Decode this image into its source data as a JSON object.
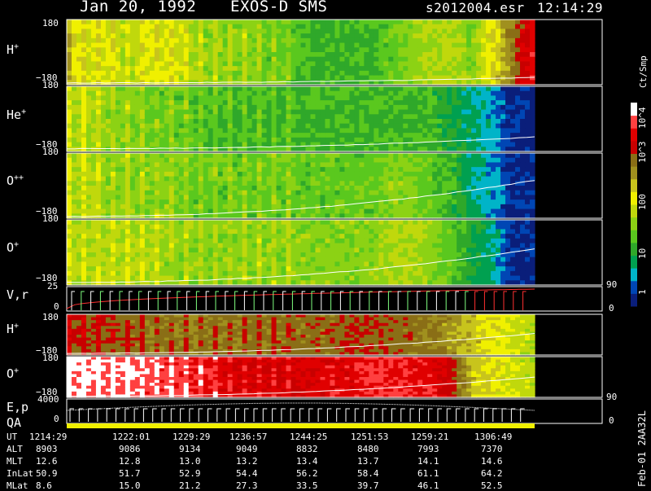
{
  "header": {
    "date": "Jan 20, 1992",
    "instrument": "EXOS-D SMS",
    "file": "s2012004.esr",
    "time": "12:14:29"
  },
  "colorbar": {
    "units": "Ct/Smp",
    "ticks": [
      "10^4",
      "10^3",
      "100",
      "10",
      "1"
    ]
  },
  "panels": {
    "p1": {
      "label": "H",
      "sup": "+",
      "ymax": "180",
      "ymin": "−180"
    },
    "p2": {
      "label": "He",
      "sup": "+",
      "ymax": "180",
      "ymin": "−180"
    },
    "p3": {
      "label": "O",
      "sup": "++",
      "ymax": "180",
      "ymin": "−180"
    },
    "p4": {
      "label": "O",
      "sup": "+",
      "ymax": "180",
      "ymin": "−180"
    },
    "vr": {
      "label": "V,r",
      "ymax": "25",
      "ymin": "0",
      "rmax": "90",
      "rmin": "0"
    },
    "p6": {
      "label": "H",
      "sup": "+",
      "ymax": "180",
      "ymin": "−180"
    },
    "p7": {
      "label": "O",
      "sup": "+",
      "ymax": "180",
      "ymin": "−180"
    },
    "ep": {
      "label1": "E,p",
      "label2": "QA",
      "ymax": "4000",
      "ymin": "0",
      "rmax": "90",
      "rmin": "0"
    }
  },
  "footer_vertical": "Feb-01 2AA32L",
  "table": {
    "rows": [
      {
        "label": "UT",
        "values": [
          "1214:29",
          "1222:01",
          "1229:29",
          "1236:57",
          "1244:25",
          "1251:53",
          "1259:21",
          "1306:49"
        ]
      },
      {
        "label": "ALT",
        "values": [
          "8903",
          "9086",
          "9134",
          "9049",
          "8832",
          "8480",
          "7993",
          "7370"
        ]
      },
      {
        "label": "MLT",
        "values": [
          "12.6",
          "12.8",
          "13.0",
          "13.2",
          "13.4",
          "13.7",
          "14.1",
          "14.6"
        ]
      },
      {
        "label": "InLat",
        "values": [
          "50.9",
          "51.7",
          "52.9",
          "54.4",
          "56.2",
          "58.4",
          "61.1",
          "64.2"
        ]
      },
      {
        "label": "MLat",
        "values": [
          "8.6",
          "15.0",
          "21.2",
          "27.3",
          "33.5",
          "39.7",
          "46.1",
          "52.5"
        ]
      }
    ]
  },
  "chart_data": [
    {
      "type": "heatmap",
      "panel": "H+",
      "ylabel": "H+",
      "ylim": [
        -180,
        180
      ],
      "profile": [
        0.55,
        0.5,
        0.5,
        0.45,
        0.5,
        0.5,
        0.45,
        0.4,
        0.4,
        0.4,
        0.35,
        0.35,
        0.3,
        0.3,
        0.3,
        0.3,
        0.35,
        0.4,
        0.45,
        0.45,
        0.4,
        0.55,
        0.7,
        0.85
      ],
      "curve": [
        -170,
        -140
      ]
    },
    {
      "type": "heatmap",
      "panel": "He+",
      "ylabel": "He+",
      "ylim": [
        -180,
        180
      ],
      "profile": [
        0.45,
        0.45,
        0.4,
        0.4,
        0.35,
        0.35,
        0.35,
        0.3,
        0.3,
        0.3,
        0.3,
        0.3,
        0.3,
        0.3,
        0.3,
        0.3,
        0.3,
        0.3,
        0.3,
        0.25,
        0.2,
        0.15,
        0.05,
        0.02
      ],
      "curve": [
        -165,
        -100
      ]
    },
    {
      "type": "heatmap",
      "panel": "O++",
      "ylabel": "O++",
      "ylim": [
        -180,
        180
      ],
      "profile": [
        0.45,
        0.45,
        0.4,
        0.4,
        0.4,
        0.4,
        0.35,
        0.35,
        0.35,
        0.35,
        0.35,
        0.35,
        0.35,
        0.35,
        0.35,
        0.35,
        0.4,
        0.4,
        0.35,
        0.3,
        0.2,
        0.15,
        0.05,
        0.05
      ],
      "curve": [
        -170,
        30
      ]
    },
    {
      "type": "heatmap",
      "panel": "O+",
      "ylabel": "O+",
      "ylim": [
        -180,
        180
      ],
      "profile": [
        0.45,
        0.45,
        0.45,
        0.45,
        0.45,
        0.4,
        0.4,
        0.4,
        0.4,
        0.4,
        0.4,
        0.4,
        0.4,
        0.4,
        0.4,
        0.4,
        0.45,
        0.45,
        0.4,
        0.35,
        0.25,
        0.2,
        0.05,
        0.05
      ],
      "curve": [
        -165,
        20
      ]
    },
    {
      "type": "line",
      "panel": "V,r",
      "ylim": [
        0,
        25
      ],
      "ylim_right": [
        0,
        90
      ]
    },
    {
      "type": "heatmap",
      "panel": "H+ (2)",
      "ylabel": "H+",
      "ylim": [
        -180,
        180
      ],
      "profile": [
        0.75,
        0.75,
        0.72,
        0.72,
        0.7,
        0.7,
        0.68,
        0.7,
        0.7,
        0.7,
        0.7,
        0.72,
        0.72,
        0.72,
        0.75,
        0.75,
        0.75,
        0.72,
        0.7,
        0.65,
        0.6,
        0.55,
        0.5,
        0.45
      ],
      "curve": [
        -165,
        10
      ]
    },
    {
      "type": "heatmap",
      "panel": "O+ (2)",
      "ylabel": "O+",
      "ylim": [
        -180,
        180
      ],
      "profile": [
        0.95,
        0.95,
        0.93,
        0.93,
        0.9,
        0.9,
        0.88,
        0.85,
        0.82,
        0.8,
        0.8,
        0.8,
        0.82,
        0.85,
        0.85,
        0.88,
        0.88,
        0.85,
        0.85,
        0.78,
        0.6,
        0.55,
        0.5,
        0.45
      ],
      "curve": [
        -170,
        0
      ]
    },
    {
      "type": "line",
      "panel": "E,p / QA",
      "ylim": [
        0,
        4000
      ],
      "ylim_right": [
        0,
        90
      ]
    }
  ]
}
